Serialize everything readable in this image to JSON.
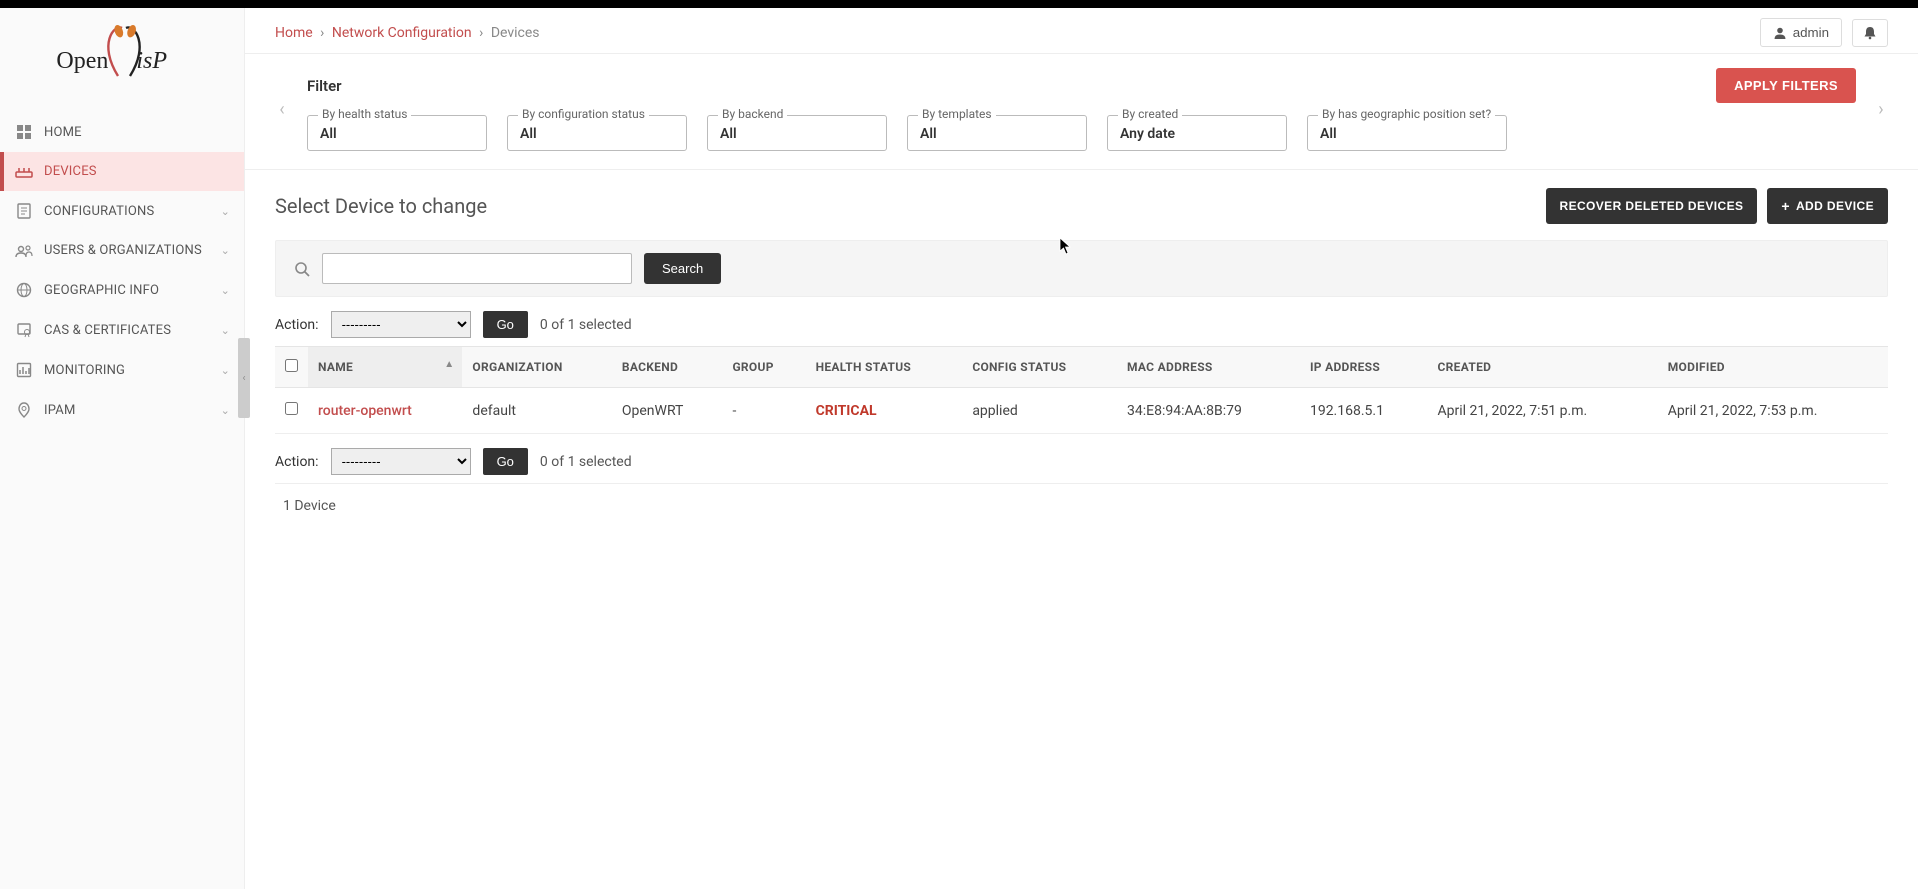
{
  "colors": {
    "accent": "#c24d4d",
    "danger": "#c0392b",
    "primary_btn": "#d9534f",
    "dark": "#333333"
  },
  "header": {
    "breadcrumb": {
      "home": "Home",
      "section": "Network Configuration",
      "page": "Devices"
    },
    "user_label": "admin"
  },
  "sidebar": {
    "items": [
      {
        "label": "HOME",
        "icon": "dashboard-icon",
        "expandable": false
      },
      {
        "label": "DEVICES",
        "icon": "device-icon",
        "expandable": false,
        "active": true
      },
      {
        "label": "CONFIGURATIONS",
        "icon": "config-icon",
        "expandable": true
      },
      {
        "label": "USERS & ORGANIZATIONS",
        "icon": "users-icon",
        "expandable": true
      },
      {
        "label": "GEOGRAPHIC INFO",
        "icon": "globe-icon",
        "expandable": true
      },
      {
        "label": "CAS & CERTIFICATES",
        "icon": "cert-icon",
        "expandable": true
      },
      {
        "label": "MONITORING",
        "icon": "monitor-icon",
        "expandable": true
      },
      {
        "label": "IPAM",
        "icon": "ipam-icon",
        "expandable": true
      }
    ]
  },
  "filters": {
    "title": "Filter",
    "apply_label": "APPLY FILTERS",
    "fields": [
      {
        "legend": "By health status",
        "value": "All"
      },
      {
        "legend": "By configuration status",
        "value": "All"
      },
      {
        "legend": "By backend",
        "value": "All"
      },
      {
        "legend": "By templates",
        "value": "All"
      },
      {
        "legend": "By created",
        "value": "Any date"
      },
      {
        "legend": "By has geographic position set?",
        "value": "All"
      }
    ]
  },
  "list": {
    "title": "Select Device to change",
    "recover_label": "RECOVER DELETED DEVICES",
    "add_label": "ADD DEVICE",
    "search_button": "Search",
    "search_placeholder": "",
    "action_label": "Action:",
    "action_placeholder": "---------",
    "go_label": "Go",
    "selection_count": "0 of 1 selected",
    "columns": [
      "NAME",
      "ORGANIZATION",
      "BACKEND",
      "GROUP",
      "HEALTH STATUS",
      "CONFIG STATUS",
      "MAC ADDRESS",
      "IP ADDRESS",
      "CREATED",
      "MODIFIED"
    ],
    "rows": [
      {
        "name": "router-openwrt",
        "organization": "default",
        "backend": "OpenWRT",
        "group": "-",
        "health_status": "CRITICAL",
        "config_status": "applied",
        "mac": "34:E8:94:AA:8B:79",
        "ip": "192.168.5.1",
        "created": "April 21, 2022, 7:51 p.m.",
        "modified": "April 21, 2022, 7:53 p.m."
      }
    ],
    "footer_count": "1 Device"
  }
}
